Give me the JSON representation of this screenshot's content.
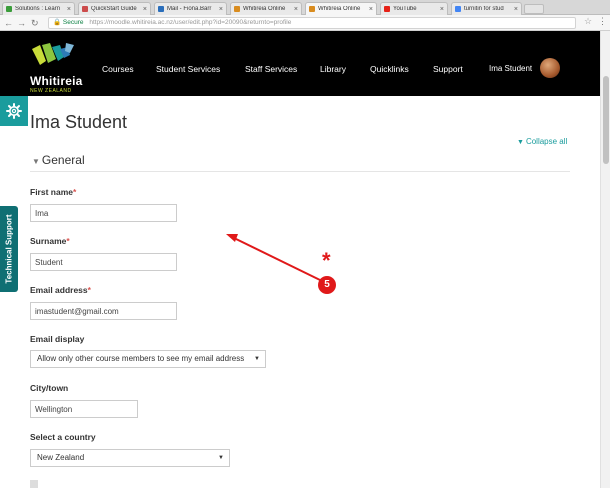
{
  "browser": {
    "tabs": [
      {
        "label": "Solutions : Learn",
        "close": "×",
        "fav": "#3a9c3a",
        "active": false
      },
      {
        "label": "QuickStart Guide",
        "close": "×",
        "fav": "#cc4b4b",
        "active": false
      },
      {
        "label": "Mail - Fiona.Barr",
        "close": "×",
        "fav": "#2a6ebb",
        "active": false
      },
      {
        "label": "Whitireia Online",
        "close": "×",
        "fav": "#d98c1f",
        "active": false
      },
      {
        "label": "Whitireia Online",
        "close": "×",
        "fav": "#d98c1f",
        "active": true
      },
      {
        "label": "YouTube",
        "close": "×",
        "fav": "#e62117",
        "active": false
      },
      {
        "label": "turnitin for stud",
        "close": "×",
        "fav": "#4285f4",
        "active": false
      }
    ],
    "secure_label": "Secure",
    "url": "https://moodle.whitireia.ac.nz/user/edit.php?id=20090&returnto=profile"
  },
  "navbar": {
    "logo_name": "Whitireia",
    "logo_sub": "NEW ZEALAND",
    "links": [
      "Courses",
      "Student Services",
      "Staff Services",
      "Library",
      "Quicklinks",
      "Support"
    ],
    "user_name": "Ima Student"
  },
  "sidebar": {
    "tech_support": "Technical Support"
  },
  "page": {
    "title": "Ima Student",
    "collapse_all": "Collapse all",
    "section": "General"
  },
  "form": {
    "first_name_label": "First name",
    "first_name_value": "Ima",
    "surname_label": "Surname",
    "surname_value": "Student",
    "email_label": "Email address",
    "email_value": "imastudent@gmail.com",
    "email_display_label": "Email display",
    "email_display_value": "Allow only other course members to see my email address",
    "city_label": "City/town",
    "city_value": "Wellington",
    "country_label": "Select a country",
    "country_value": "New Zealand",
    "required_mark": "*"
  },
  "annotation": {
    "step": "5",
    "mark": "*",
    "color": "#e0191a"
  },
  "colors": {
    "accent": "#1a9c9d",
    "navbar_bg": "#000000",
    "required": "#d9534f"
  }
}
